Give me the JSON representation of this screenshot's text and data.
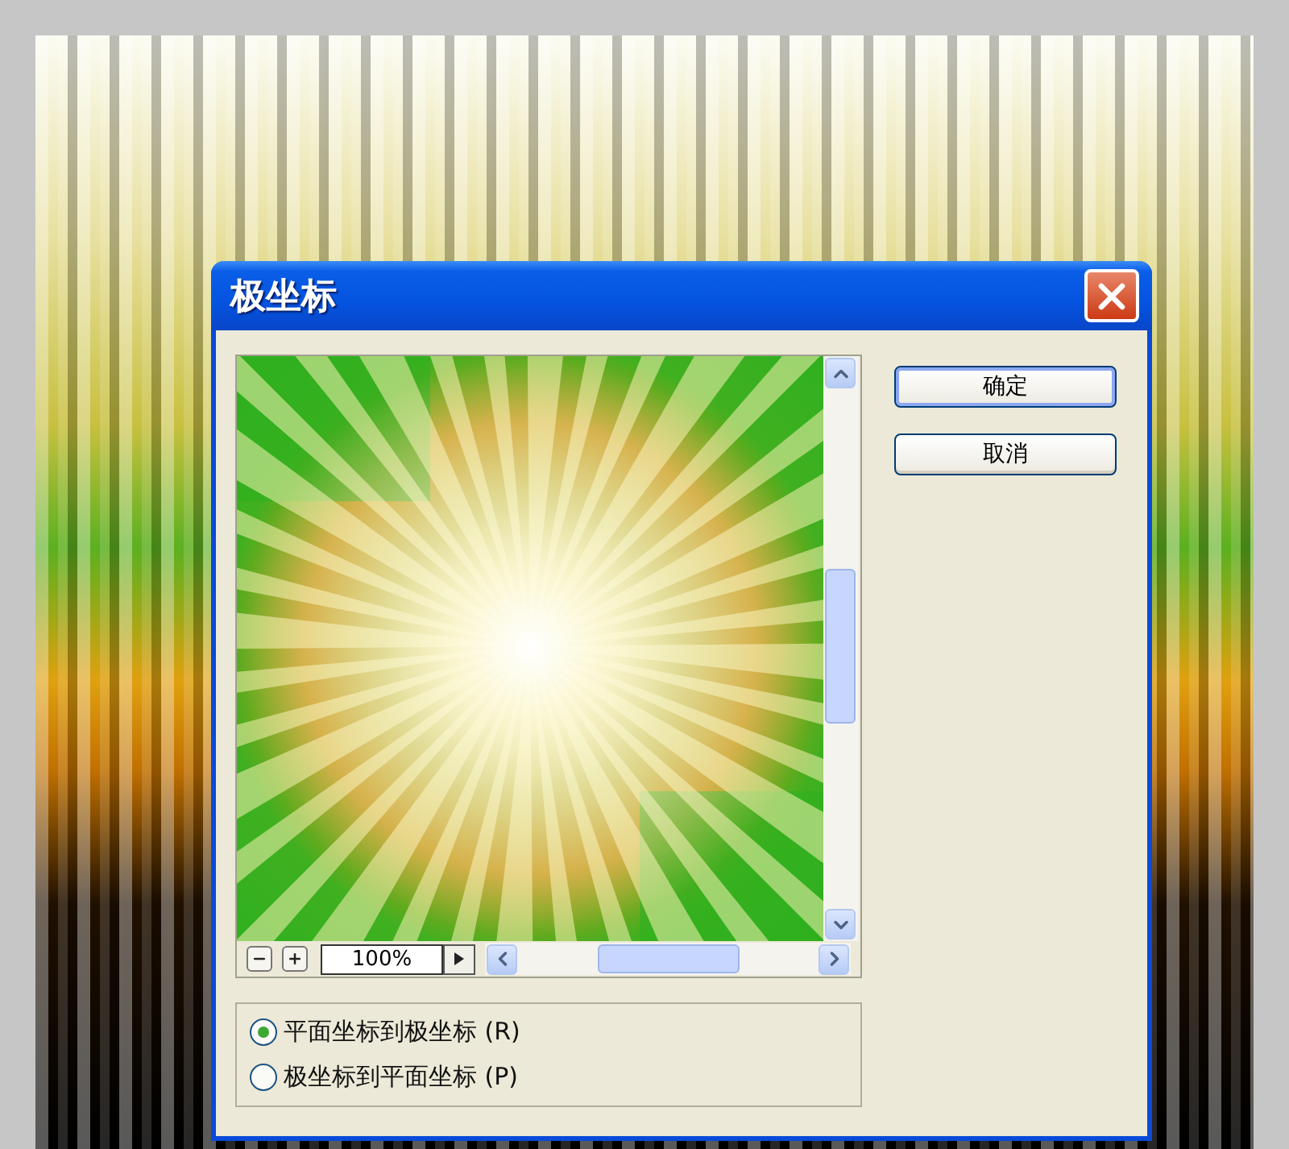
{
  "dialog": {
    "title": "极坐标",
    "preview": {
      "zoom": "100%"
    },
    "buttons": [
      {
        "label": "确定",
        "default": true
      },
      {
        "label": "取消",
        "default": false
      }
    ],
    "options": [
      {
        "label": "平面坐标到极坐标 (R)",
        "selected": true
      },
      {
        "label": "极坐标到平面坐标 (P)",
        "selected": false
      }
    ]
  }
}
